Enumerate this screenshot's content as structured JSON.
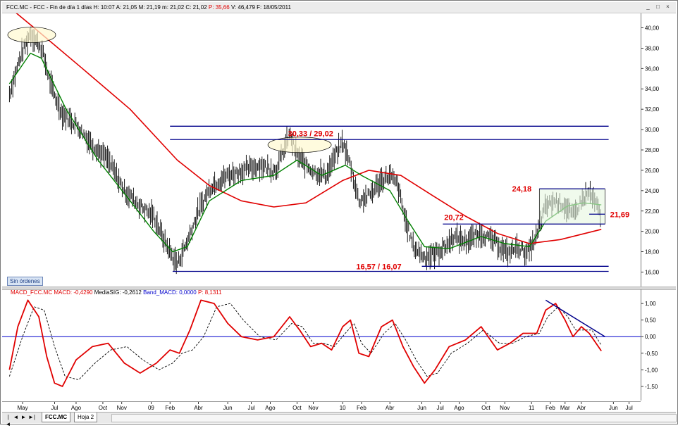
{
  "window": {
    "title_parts": [
      "FCC.MC - FCC - Fin de día 1 días",
      "H: 10:07",
      "A: 21,05",
      "M: 21,19",
      "m: 21,02",
      "C: 21,02"
    ],
    "title_highlight": "P: 35,66",
    "title_tail": [
      "V: 46,479",
      "F: 18/05/2011"
    ],
    "buttons": [
      "_",
      "□",
      "×"
    ]
  },
  "macd_header": {
    "name": "MACD_FCC.MC",
    "macd": "MACD: -0,4290",
    "signal": "MediaSIG: -0,2612",
    "band": "Band_MACD: 0,0000",
    "p": "P: 8,1311"
  },
  "badge": "Sin órdenes",
  "tabs": {
    "active": "FCC.MC",
    "other": "Hoja 2"
  },
  "nav": [
    "|◄",
    "◄",
    "►",
    "►|"
  ],
  "colors": {
    "price": "#000000",
    "ma_fast": "#008000",
    "ma_slow": "#e00000",
    "levels": "#00008b",
    "macd": "#e00000",
    "signal": "#000000",
    "zero": "#0000cc",
    "annotation": "#e00000"
  },
  "chart_data": [
    {
      "type": "line",
      "title": "",
      "series": [
        {
          "name": "",
          "x": [
            "2008-04-15",
            "2008-05-05",
            "2008-05-25",
            "2008-06-15",
            "2008-07-05",
            "2008-07-25",
            "2008-08-20",
            "2008-09-20",
            "2008-10-20",
            "2008-11-20",
            "2008-12-20",
            "2009-01-15",
            "2009-02-05",
            "2009-02-20",
            "2009-03-01",
            "2009-03-20",
            "2009-04-10",
            "2009-05-05",
            "2009-06-05",
            "2009-07-05",
            "2009-08-05",
            "2009-09-05",
            "2009-10-01",
            "2009-10-15",
            "2009-11-01",
            "2009-11-20",
            "2009-12-10",
            "2009-12-28",
            "2010-01-10",
            "2010-01-25",
            "2010-02-10",
            "2010-03-01",
            "2010-03-25",
            "2010-04-10",
            "2010-04-25",
            "2010-05-10",
            "2010-05-25",
            "2010-06-15",
            "2010-07-05",
            "2010-07-25",
            "2010-08-10",
            "2010-09-01",
            "2010-10-01",
            "2010-11-01",
            "2010-11-20",
            "2010-12-10",
            "2010-12-28",
            "2011-01-15",
            "2011-02-01",
            "2011-02-20",
            "2011-03-10",
            "2011-03-25",
            "2011-04-10",
            "2011-04-25",
            "2011-05-10",
            "2011-05-18"
          ],
          "y": [
            33.5,
            37.0,
            39.5,
            38.0,
            34.0,
            31.5,
            30.5,
            28.5,
            27.0,
            24.0,
            22.5,
            21.5,
            19.0,
            17.5,
            16.8,
            19.0,
            22.0,
            24.5,
            25.5,
            26.0,
            26.5,
            26.0,
            29.5,
            27.5,
            26.5,
            25.8,
            25.5,
            27.5,
            28.8,
            26.5,
            23.0,
            23.5,
            25.0,
            25.5,
            24.5,
            21.0,
            18.5,
            17.5,
            17.8,
            18.5,
            19.5,
            19.0,
            19.8,
            18.8,
            17.8,
            18.5,
            17.8,
            19.5,
            22.5,
            23.0,
            22.5,
            21.5,
            23.0,
            23.8,
            22.5,
            21.0
          ]
        },
        {
          "name": "",
          "x": [
            "2008-04-15",
            "2008-05-25",
            "2008-06-15",
            "2008-08-01",
            "2008-10-01",
            "2008-12-01",
            "2009-01-15",
            "2009-02-20",
            "2009-03-20",
            "2009-05-01",
            "2009-07-01",
            "2009-09-01",
            "2009-10-15",
            "2009-12-01",
            "2010-01-15",
            "2010-02-15",
            "2010-04-10",
            "2010-05-15",
            "2010-06-15",
            "2010-08-01",
            "2010-10-01",
            "2010-11-15",
            "2011-01-01",
            "2011-02-01",
            "2011-03-15",
            "2011-04-15",
            "2011-05-18"
          ],
          "y": [
            34.5,
            37.5,
            37.0,
            32.0,
            27.0,
            23.0,
            20.0,
            18.0,
            18.5,
            23.0,
            25.0,
            25.5,
            27.0,
            25.5,
            26.5,
            25.5,
            24.0,
            21.0,
            18.5,
            18.3,
            19.5,
            18.8,
            18.5,
            21.0,
            22.5,
            22.8,
            22.6
          ]
        },
        {
          "name": "",
          "x": [
            "2008-04-15",
            "2008-06-01",
            "2008-09-01",
            "2008-12-01",
            "2009-03-01",
            "2009-05-01",
            "2009-07-01",
            "2009-09-01",
            "2009-11-01",
            "2010-01-10",
            "2010-03-01",
            "2010-05-01",
            "2010-07-01",
            "2010-09-01",
            "2010-11-01",
            "2011-01-01",
            "2011-03-01",
            "2011-05-18"
          ],
          "y": [
            42.0,
            40.0,
            36.0,
            32.0,
            27.0,
            24.5,
            23.0,
            22.4,
            22.8,
            25.0,
            26.0,
            25.5,
            23.5,
            21.5,
            19.8,
            18.8,
            19.2,
            20.2
          ]
        }
      ],
      "annotations": [
        "30,33 / 29,02",
        "16,57 / 16,07",
        "20,72",
        "24,18",
        "21,69"
      ],
      "levels": [
        30.33,
        29.02,
        16.57,
        16.07,
        20.72,
        24.18,
        21.69
      ],
      "ylim": [
        15,
        41
      ],
      "yticks": [
        "40,00",
        "38,00",
        "36,00",
        "34,00",
        "32,00",
        "30,00",
        "28,00",
        "26,00",
        "24,00",
        "22,00",
        "20,00",
        "18,00",
        "16,00"
      ],
      "grid": false
    },
    {
      "type": "line",
      "title": "",
      "series": [
        {
          "name": "MACD",
          "x": [
            "2008-04-15",
            "2008-05-01",
            "2008-05-20",
            "2008-06-10",
            "2008-06-25",
            "2008-07-10",
            "2008-07-25",
            "2008-08-20",
            "2008-09-20",
            "2008-10-20",
            "2008-11-20",
            "2008-12-20",
            "2009-01-20",
            "2009-02-15",
            "2009-03-05",
            "2009-03-25",
            "2009-04-15",
            "2009-05-10",
            "2009-06-05",
            "2009-07-01",
            "2009-08-01",
            "2009-09-01",
            "2009-10-01",
            "2009-10-20",
            "2009-11-10",
            "2009-12-01",
            "2009-12-20",
            "2010-01-10",
            "2010-01-25",
            "2010-02-10",
            "2010-03-01",
            "2010-03-25",
            "2010-04-15",
            "2010-05-05",
            "2010-05-25",
            "2010-06-15",
            "2010-07-05",
            "2010-08-01",
            "2010-09-01",
            "2010-10-01",
            "2010-11-01",
            "2010-11-25",
            "2010-12-20",
            "2011-01-15",
            "2011-02-01",
            "2011-02-20",
            "2011-03-10",
            "2011-03-25",
            "2011-04-10",
            "2011-04-25",
            "2011-05-18"
          ],
          "y": [
            -1.0,
            0.3,
            1.1,
            0.6,
            -0.6,
            -1.4,
            -1.5,
            -0.7,
            -0.3,
            -0.2,
            -0.8,
            -1.1,
            -0.8,
            -0.4,
            -0.5,
            0.2,
            1.1,
            1.0,
            0.4,
            0.0,
            -0.1,
            0.0,
            0.6,
            0.2,
            -0.3,
            -0.2,
            -0.4,
            0.3,
            0.5,
            -0.5,
            -0.6,
            0.3,
            0.5,
            -0.3,
            -0.9,
            -1.4,
            -1.0,
            -0.3,
            -0.1,
            0.3,
            -0.4,
            -0.2,
            0.1,
            0.1,
            0.8,
            1.0,
            0.5,
            0.0,
            0.3,
            0.1,
            -0.43
          ]
        },
        {
          "name": "MediaSIG",
          "x": [
            "2008-04-15",
            "2008-05-10",
            "2008-06-01",
            "2008-06-20",
            "2008-07-10",
            "2008-07-30",
            "2008-08-25",
            "2008-09-25",
            "2008-10-25",
            "2008-11-25",
            "2008-12-25",
            "2009-01-25",
            "2009-02-20",
            "2009-03-10",
            "2009-03-30",
            "2009-04-20",
            "2009-05-15",
            "2009-06-10",
            "2009-07-05",
            "2009-08-05",
            "2009-09-05",
            "2009-10-05",
            "2009-10-25",
            "2009-11-15",
            "2009-12-05",
            "2009-12-25",
            "2010-01-15",
            "2010-02-01",
            "2010-02-15",
            "2010-03-05",
            "2010-03-30",
            "2010-04-20",
            "2010-05-10",
            "2010-05-30",
            "2010-06-20",
            "2010-07-10",
            "2010-08-05",
            "2010-09-05",
            "2010-10-05",
            "2010-11-05",
            "2010-11-30",
            "2010-12-25",
            "2011-01-20",
            "2011-02-05",
            "2011-02-25",
            "2011-03-15",
            "2011-03-30",
            "2011-04-15",
            "2011-04-30",
            "2011-05-18"
          ],
          "y": [
            -1.2,
            0.0,
            0.9,
            0.8,
            -0.3,
            -1.2,
            -1.3,
            -0.8,
            -0.4,
            -0.3,
            -0.7,
            -1.0,
            -0.8,
            -0.5,
            -0.4,
            0.0,
            0.9,
            1.0,
            0.5,
            0.0,
            -0.1,
            0.4,
            0.3,
            -0.2,
            -0.2,
            -0.3,
            0.1,
            0.4,
            -0.2,
            -0.5,
            0.1,
            0.4,
            -0.1,
            -0.7,
            -1.2,
            -1.1,
            -0.5,
            -0.2,
            0.2,
            -0.2,
            -0.2,
            0.0,
            0.1,
            0.6,
            0.9,
            0.6,
            0.2,
            0.2,
            0.2,
            -0.26
          ]
        }
      ],
      "ylim": [
        -1.8,
        1.3
      ],
      "yticks": [
        "1,00",
        "0,50",
        "0,00",
        "-0,50",
        "-1,00",
        "-1,50"
      ],
      "xticks": [
        "May",
        "Jul",
        "Ago",
        "Oct",
        "Nov",
        "09",
        "Feb",
        "Abr",
        "Jun",
        "Jul",
        "Ago",
        "Oct",
        "Nov",
        "10",
        "Feb",
        "Abr",
        "Jun",
        "Jul",
        "Ago",
        "Oct",
        "Nov",
        "11",
        "Feb",
        "Mar",
        "Abr",
        "Jun",
        "Jul"
      ],
      "grid": false
    }
  ]
}
